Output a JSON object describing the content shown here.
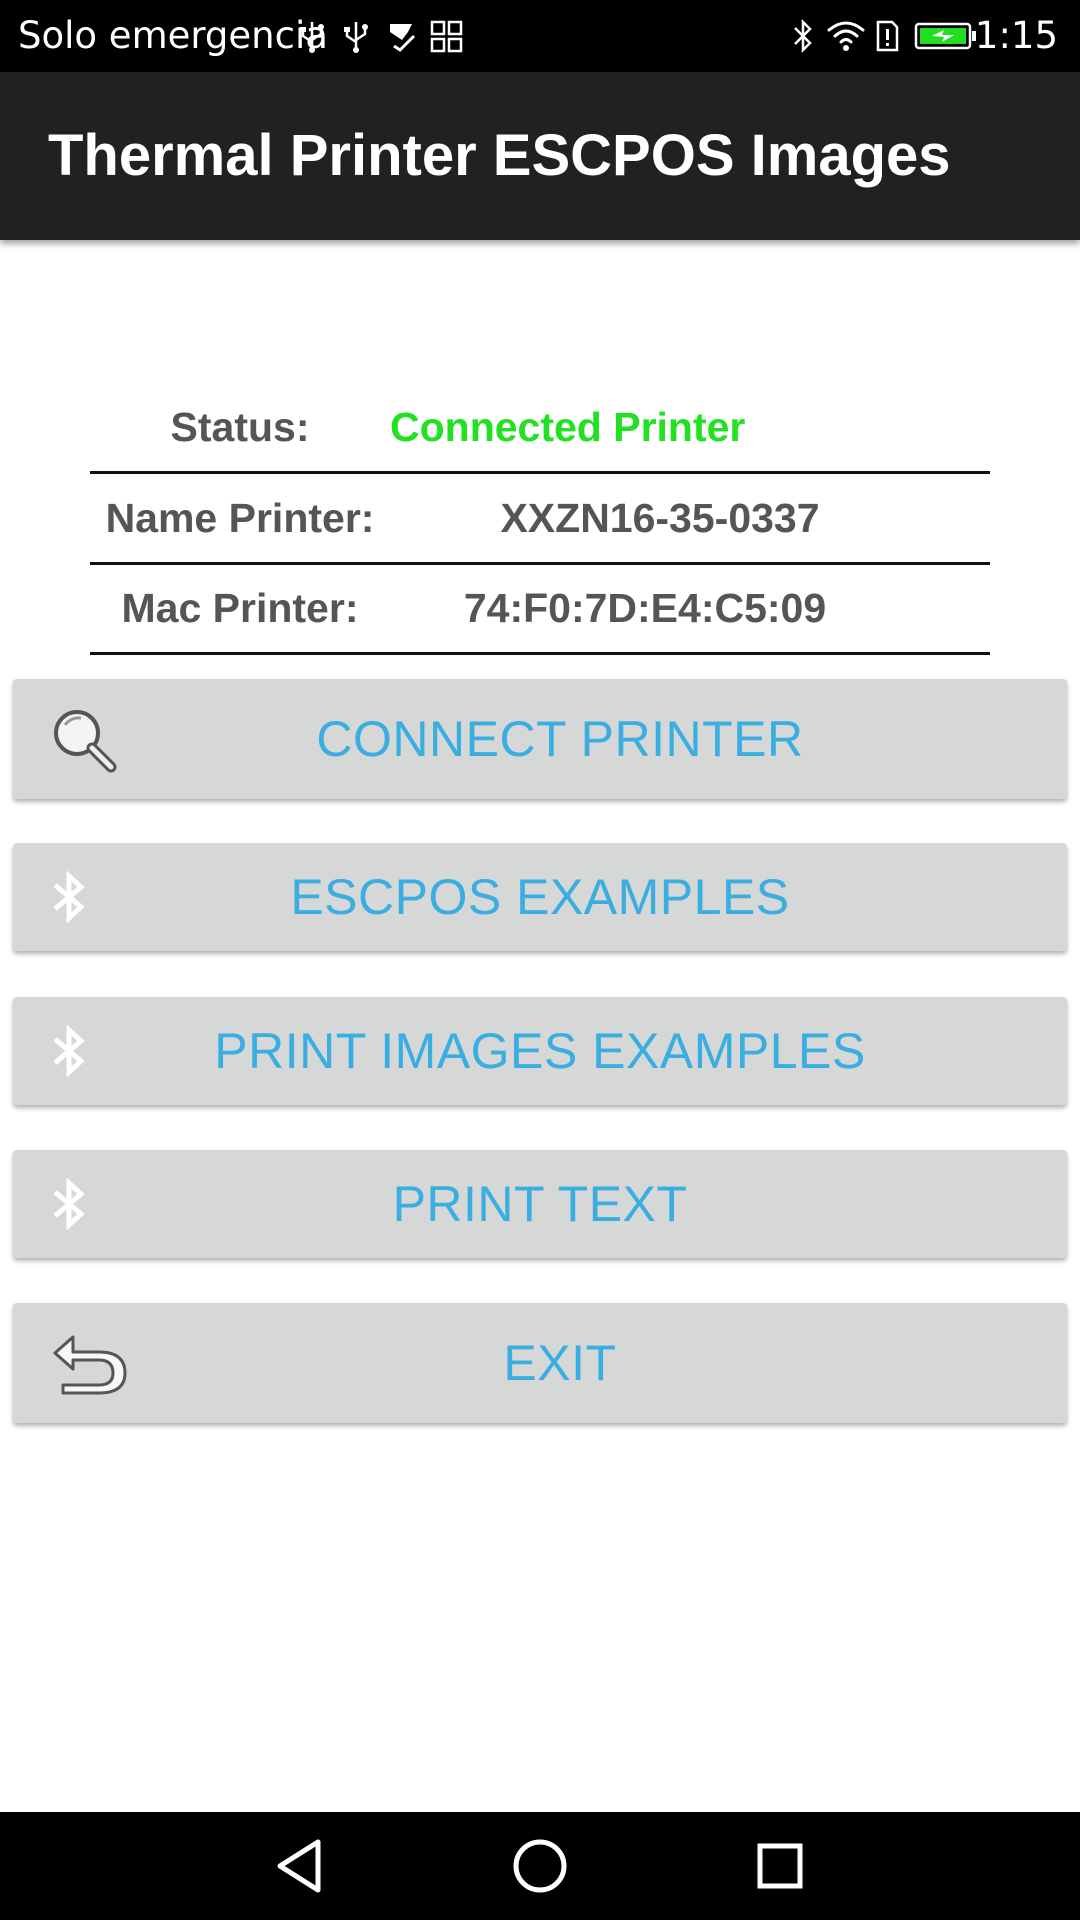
{
  "status_bar": {
    "carrier": "Solo emergencia",
    "time": "1:15",
    "icons": [
      "usb-icon",
      "usb-icon",
      "download-check-icon",
      "apps-icon",
      "bluetooth-icon",
      "wifi-icon",
      "alert-icon",
      "battery-charging-icon"
    ],
    "battery_color": "#22dd22"
  },
  "app_bar": {
    "title": "Thermal Printer ESCPOS Images",
    "background": "#212121"
  },
  "info": {
    "status_label": "Status:",
    "status_value": "Connected Printer",
    "status_color": "#22e022",
    "name_label": "Name Printer:",
    "name_value": "XXZN16-35-0337",
    "mac_label": "Mac Printer:",
    "mac_value": "74:F0:7D:E4:C5:09"
  },
  "buttons": {
    "connect": {
      "label": "CONNECT PRINTER",
      "icon": "search-icon"
    },
    "escpos": {
      "label": "ESCPOS EXAMPLES",
      "icon": "bluetooth-icon"
    },
    "print_images": {
      "label": "PRINT IMAGES EXAMPLES",
      "icon": "bluetooth-icon"
    },
    "print_text": {
      "label": "PRINT TEXT",
      "icon": "bluetooth-icon"
    },
    "exit": {
      "label": "EXIT",
      "icon": "back-arrow-icon"
    }
  },
  "colors": {
    "button_bg": "#d6d7d7",
    "button_text": "#3aaee0"
  },
  "nav_bar": {
    "buttons": [
      "back-triangle-icon",
      "home-circle-icon",
      "recents-square-icon"
    ]
  }
}
